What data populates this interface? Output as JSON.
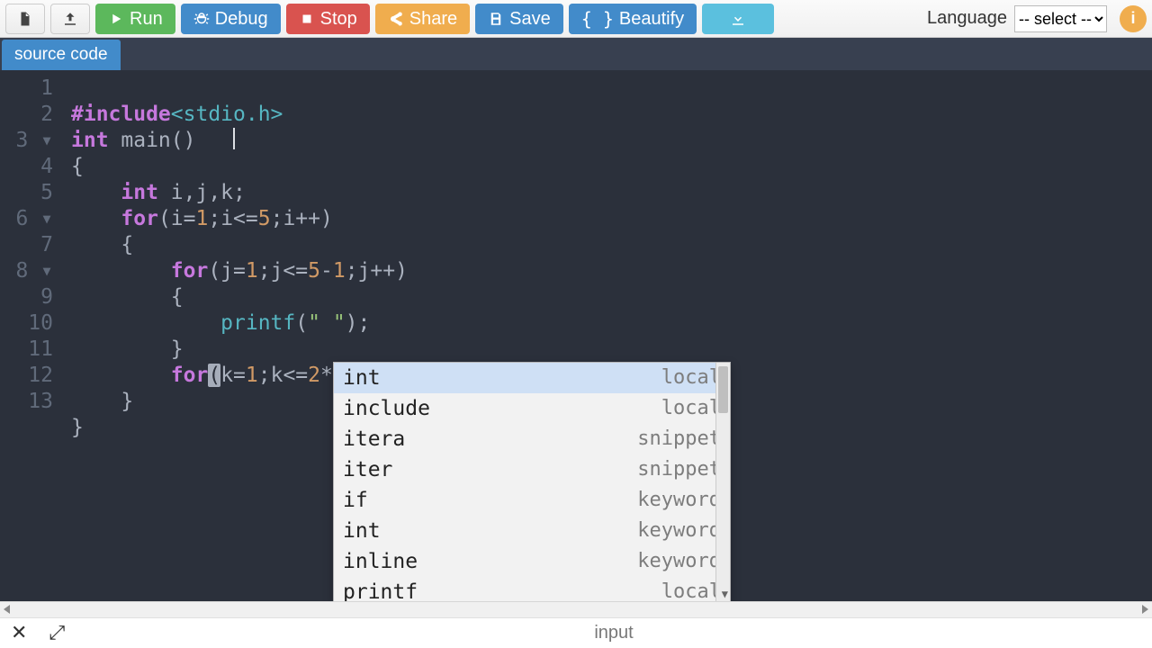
{
  "toolbar": {
    "run": "Run",
    "debug": "Debug",
    "stop": "Stop",
    "share": "Share",
    "save": "Save",
    "beautify": "Beautify"
  },
  "language": {
    "label": "Language",
    "selected": "-- select --"
  },
  "tab": {
    "label": "source code"
  },
  "gutter_lines": [
    "1",
    "2",
    "3",
    "4",
    "5",
    "6",
    "7",
    "8",
    "9",
    "10",
    "11",
    "12",
    "13"
  ],
  "code": {
    "l1_a": "#include",
    "l1_b": "<stdio.h>",
    "l2_a": "int",
    "l2_b": " main()",
    "l3": "{",
    "l4_a": "    ",
    "l4_b": "int",
    "l4_c": " i,j,k;",
    "l5_a": "    ",
    "l5_b": "for",
    "l5_c": "(i=",
    "l5_d": "1",
    "l5_e": ";i<=",
    "l5_f": "5",
    "l5_g": ";i++)",
    "l6": "    {",
    "l7_a": "        ",
    "l7_b": "for",
    "l7_c": "(j=",
    "l7_d": "1",
    "l7_e": ";j<=",
    "l7_f": "5",
    "l7_g": "-",
    "l7_h": "1",
    "l7_i": ";j++)",
    "l8": "        {",
    "l9_a": "            ",
    "l9_b": "printf",
    "l9_c": "(",
    "l9_d": "\" \"",
    "l9_e": ");",
    "l10": "        }",
    "l11_a": "        ",
    "l11_b": "for",
    "l11_c": "(",
    "l11_d": "k=",
    "l11_e": "1",
    "l11_f": ";k<=",
    "l11_g": "2",
    "l11_h": "*i",
    "l11_i": ")",
    "l12": "    }",
    "l13": "}"
  },
  "autocomplete": [
    {
      "label": "int",
      "type": "local",
      "selected": true
    },
    {
      "label": "include",
      "type": "local",
      "selected": false
    },
    {
      "label": "itera",
      "type": "snippet",
      "selected": false
    },
    {
      "label": "iter",
      "type": "snippet",
      "selected": false
    },
    {
      "label": "if",
      "type": "keyword",
      "selected": false
    },
    {
      "label": "int",
      "type": "keyword",
      "selected": false
    },
    {
      "label": "inline",
      "type": "keyword",
      "selected": false
    },
    {
      "label": "printf",
      "type": "local",
      "selected": false
    }
  ],
  "bottom": {
    "close": "✕",
    "expand": "⤢",
    "title": "input"
  }
}
